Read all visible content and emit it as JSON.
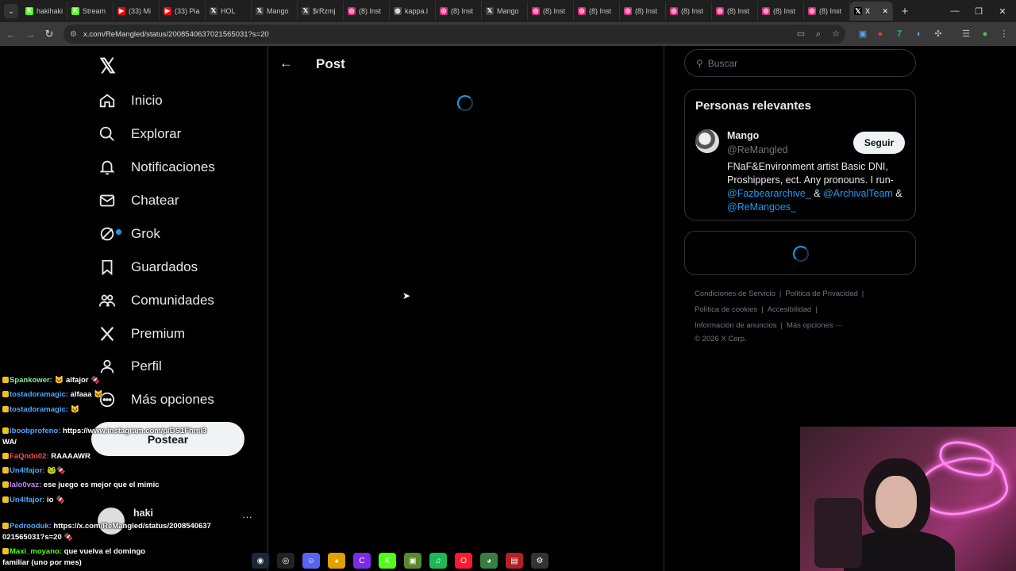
{
  "browser": {
    "tabs": [
      {
        "label": "hakihaki",
        "color": "#53fc18",
        "glyph": "K"
      },
      {
        "label": "Stream",
        "color": "#53fc18",
        "glyph": "K"
      },
      {
        "label": "(33) Mi",
        "color": "#ff0000",
        "glyph": "▶"
      },
      {
        "label": "(33) Pia",
        "color": "#ff0000",
        "glyph": "▶"
      },
      {
        "label": "HOL",
        "color": "#444",
        "glyph": "𝕏"
      },
      {
        "label": "Mango",
        "color": "#444",
        "glyph": "𝕏"
      },
      {
        "label": "$rRzmj",
        "color": "#444",
        "glyph": "𝕏"
      },
      {
        "label": "(8) Inst",
        "color": "#d62976",
        "glyph": "◎"
      },
      {
        "label": "kappa.l",
        "color": "#555",
        "glyph": "◍"
      },
      {
        "label": "(8) Inst",
        "color": "#d62976",
        "glyph": "◎"
      },
      {
        "label": "Mango",
        "color": "#444",
        "glyph": "𝕏"
      },
      {
        "label": "(8) Inst",
        "color": "#d62976",
        "glyph": "◎"
      },
      {
        "label": "(8) Inst",
        "color": "#d62976",
        "glyph": "◎"
      },
      {
        "label": "(8) Inst",
        "color": "#d62976",
        "glyph": "◎"
      },
      {
        "label": "(8) Inst",
        "color": "#d62976",
        "glyph": "◎"
      },
      {
        "label": "(8) Inst",
        "color": "#d62976",
        "glyph": "◎"
      },
      {
        "label": "(8) Inst",
        "color": "#d62976",
        "glyph": "◎"
      },
      {
        "label": "(8) Inst",
        "color": "#d62976",
        "glyph": "◎"
      }
    ],
    "active_tab": {
      "label": "X",
      "close": "✕"
    },
    "new_tab": "+",
    "url": "x.com/ReMangled/status/2008540637021565031?s=20"
  },
  "left_nav": {
    "items": [
      {
        "label": "Inicio",
        "icon": "home-icon"
      },
      {
        "label": "Explorar",
        "icon": "search-icon"
      },
      {
        "label": "Notificaciones",
        "icon": "bell-icon"
      },
      {
        "label": "Chatear",
        "icon": "mail-icon"
      },
      {
        "label": "Grok",
        "icon": "grok-icon"
      },
      {
        "label": "Guardados",
        "icon": "bookmark-icon"
      },
      {
        "label": "Comunidades",
        "icon": "people-icon"
      },
      {
        "label": "Premium",
        "icon": "x-premium-icon"
      },
      {
        "label": "Perfil",
        "icon": "profile-icon"
      },
      {
        "label": "Más opciones",
        "icon": "more-circle-icon"
      }
    ],
    "post_button": "Postear",
    "account_name": "haki",
    "account_more": "···"
  },
  "main": {
    "title": "Post"
  },
  "right": {
    "search_placeholder": "Buscar",
    "relevant": {
      "title": "Personas relevantes",
      "name": "Mango",
      "handle": "@ReMangled",
      "follow": "Seguir",
      "bio_text": "FNaF&Environment artist Basic DNI, Proshippers, ect. Any pronouns. I run-",
      "bio_link1": "@Fazbeararchive_",
      "bio_amp1": " & ",
      "bio_link2": "@ArchivalTeam",
      "bio_amp2": " &",
      "bio_link3": "@ReMangoes_"
    },
    "footer": {
      "terms": "Condiciones de Servicio",
      "privacy": "Política de Privacidad",
      "cookies": "Política de cookies",
      "accessibility": "Accesibilidad",
      "ads": "Información de anuncios",
      "more": "Más opciones ···",
      "copyright": "© 2026 X Corp."
    }
  },
  "chat": [
    {
      "user": "Spankower:",
      "color": "#7ef0a0",
      "msg": "🐱 alfajor 🍫"
    },
    {
      "user": "tostadoramagic:",
      "color": "#4aa8ff",
      "msg": "alfaaa 🐱"
    },
    {
      "user": "tostadoramagic:",
      "color": "#4aa8ff",
      "msg": "🐱"
    },
    {
      "user": "iboobprofeno:",
      "color": "#4aa8ff",
      "msg": "https://www.instagram.com/p/DS1Fhmi3"
    },
    {
      "user": "",
      "color": "#fff",
      "msg": "WA/"
    },
    {
      "user": "FaQndo02:",
      "color": "#ff4b4b",
      "msg": "RAAAAWR"
    },
    {
      "user": "Un4lfajor:",
      "color": "#4aa8ff",
      "msg": "🐸🍫"
    },
    {
      "user": "lalo0vaz:",
      "color": "#c97fff",
      "msg": "ese juego es mejor que el mimic"
    },
    {
      "user": "Un4lfajor:",
      "color": "#4aa8ff",
      "msg": "io 🍫"
    },
    {
      "user": "Pedrooduk:",
      "color": "#4aa8ff",
      "msg": "https://x.com/ReMangled/status/2008540637"
    },
    {
      "user": "",
      "color": "#fff",
      "msg": "021565031?s=20 🍫"
    },
    {
      "user": "Maxi_moyano:",
      "color": "#53fc18",
      "msg": "que vuelva el domingo"
    },
    {
      "user": "",
      "color": "#fff",
      "msg": "familiar (uno por mes)"
    }
  ],
  "taskbar": [
    {
      "name": "steam-icon",
      "glyph": "◉",
      "bg": "#1b2838"
    },
    {
      "name": "obs-icon",
      "glyph": "◎",
      "bg": "#222"
    },
    {
      "name": "discord-icon",
      "glyph": "☺",
      "bg": "#5865f2"
    },
    {
      "name": "chrome-icon",
      "glyph": "◕",
      "bg": "#e0a100"
    },
    {
      "name": "canva-icon",
      "glyph": "C",
      "bg": "#7d2ae8"
    },
    {
      "name": "kick-icon",
      "glyph": "K",
      "bg": "#53fc18"
    },
    {
      "name": "minecraft-icon",
      "glyph": "▣",
      "bg": "#5b8731"
    },
    {
      "name": "spotify-icon",
      "glyph": "♫",
      "bg": "#1db954"
    },
    {
      "name": "opera-icon",
      "glyph": "O",
      "bg": "#ff1b2d"
    },
    {
      "name": "chrome-active-icon",
      "glyph": "◕",
      "bg": "#3a7d44"
    },
    {
      "name": "streamer-app-icon",
      "glyph": "▤",
      "bg": "#b22222"
    },
    {
      "name": "settings-icon",
      "glyph": "⚙",
      "bg": "#333"
    }
  ]
}
